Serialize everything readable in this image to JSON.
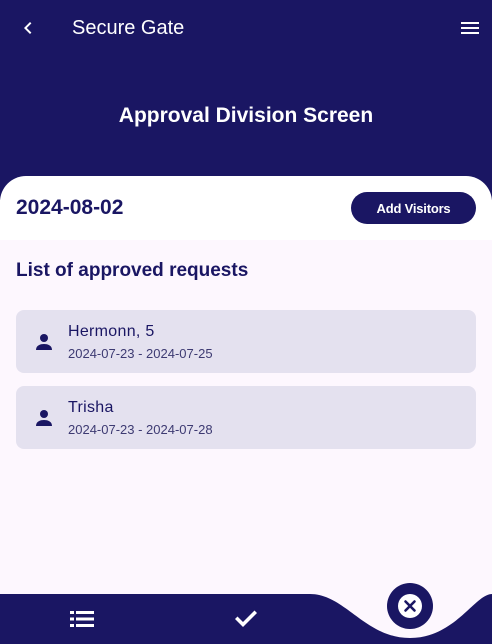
{
  "app_bar": {
    "title": "Secure Gate",
    "back_icon": "chevron-left-icon",
    "menu_icon": "hamburger-menu-icon"
  },
  "screen_title": "Approval Division Screen",
  "date_card": {
    "date": "2024-08-02",
    "add_button_label": "Add Visitors"
  },
  "list": {
    "heading": "List of approved requests",
    "items": [
      {
        "name": "Hermonn, 5",
        "dates": "2024-07-23 - 2024-07-25",
        "icon": "person-icon"
      },
      {
        "name": "Trisha",
        "dates": "2024-07-23 - 2024-07-28",
        "icon": "person-icon"
      }
    ]
  },
  "bottom_nav": {
    "items": [
      {
        "icon": "list-icon"
      },
      {
        "icon": "checkmark-icon"
      }
    ],
    "fab_icon": "close-circle-icon"
  },
  "colors": {
    "primary": "#1a1663",
    "background": "#fdf7fe",
    "card": "#e4e1ef",
    "white": "#ffffff"
  }
}
